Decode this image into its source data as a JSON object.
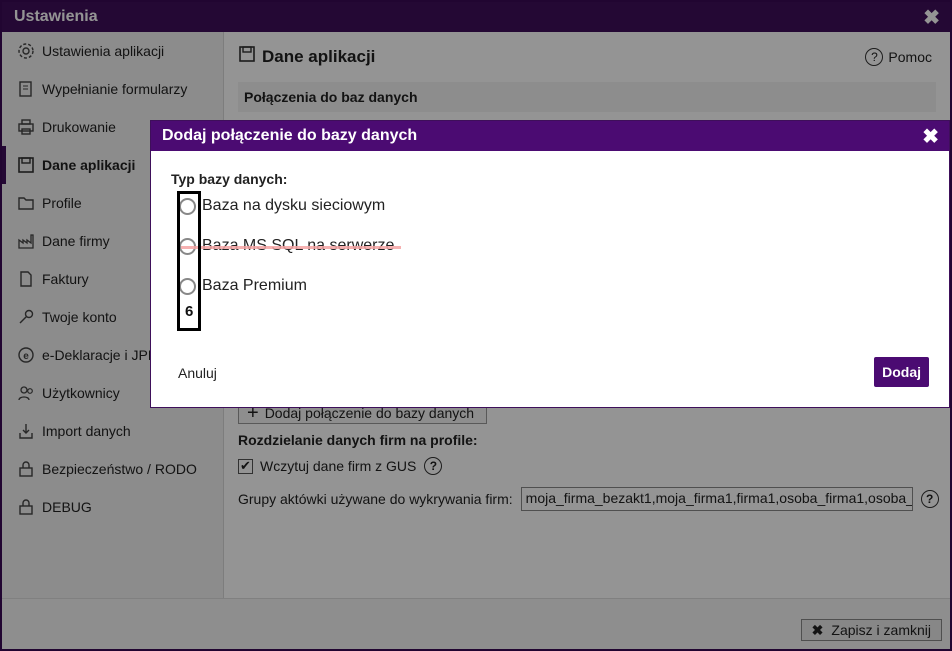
{
  "window": {
    "title": "Ustawienia",
    "close_glyph": "✖"
  },
  "sidebar": {
    "items": [
      {
        "label": "Ustawienia aplikacji",
        "icon": "gear-icon"
      },
      {
        "label": "Wypełnianie formularzy",
        "icon": "form-icon"
      },
      {
        "label": "Drukowanie",
        "icon": "printer-icon"
      },
      {
        "label": "Dane aplikacji",
        "icon": "save-icon",
        "active": true
      },
      {
        "label": "Profile",
        "icon": "folder-icon"
      },
      {
        "label": "Dane firmy",
        "icon": "factory-icon"
      },
      {
        "label": "Faktury",
        "icon": "invoice-icon"
      },
      {
        "label": "Twoje konto",
        "icon": "key-icon"
      },
      {
        "label": "e-Deklaracje i JPK",
        "icon": "e-icon"
      },
      {
        "label": "Użytkownicy",
        "icon": "users-icon"
      },
      {
        "label": "Import danych",
        "icon": "import-icon"
      },
      {
        "label": "Bezpieczeństwo / RODO",
        "icon": "lock-icon"
      },
      {
        "label": "DEBUG",
        "icon": "lock-icon"
      }
    ]
  },
  "main": {
    "title": "Dane aplikacji",
    "help_label": "Pomoc",
    "help_glyph": "?",
    "section_title": "Połączenia do baz danych",
    "add_connection_label": "Dodaj połączenie do bazy danych",
    "split_label": "Rozdzielanie danych firm na profile:",
    "gus_label": "Wczytuj dane firm z GUS",
    "gus_checked": true,
    "groups_label": "Grupy aktówki używane do wykrywania firm:",
    "groups_value": "moja_firma_bezakt1,moja_firma1,firma1,osoba_firma1,osoba_",
    "qmark": "?"
  },
  "footer": {
    "save_close_label": "Zapisz i zamknij",
    "save_close_glyph": "✖"
  },
  "dialog": {
    "title": "Dodaj połączenie do bazy danych",
    "close_glyph": "✖",
    "type_label": "Typ bazy danych:",
    "options": [
      {
        "label": "Baza na dysku sieciowym"
      },
      {
        "label": "Baza MS SQL na serwerze",
        "struck": true
      },
      {
        "label": "Baza Premium"
      }
    ],
    "annotation_number": "6",
    "cancel_label": "Anuluj",
    "add_label": "Dodaj"
  },
  "colors": {
    "accent": "#4b0b72",
    "titlebar": "#3e0f5a",
    "strike": "#f4a3a3"
  }
}
